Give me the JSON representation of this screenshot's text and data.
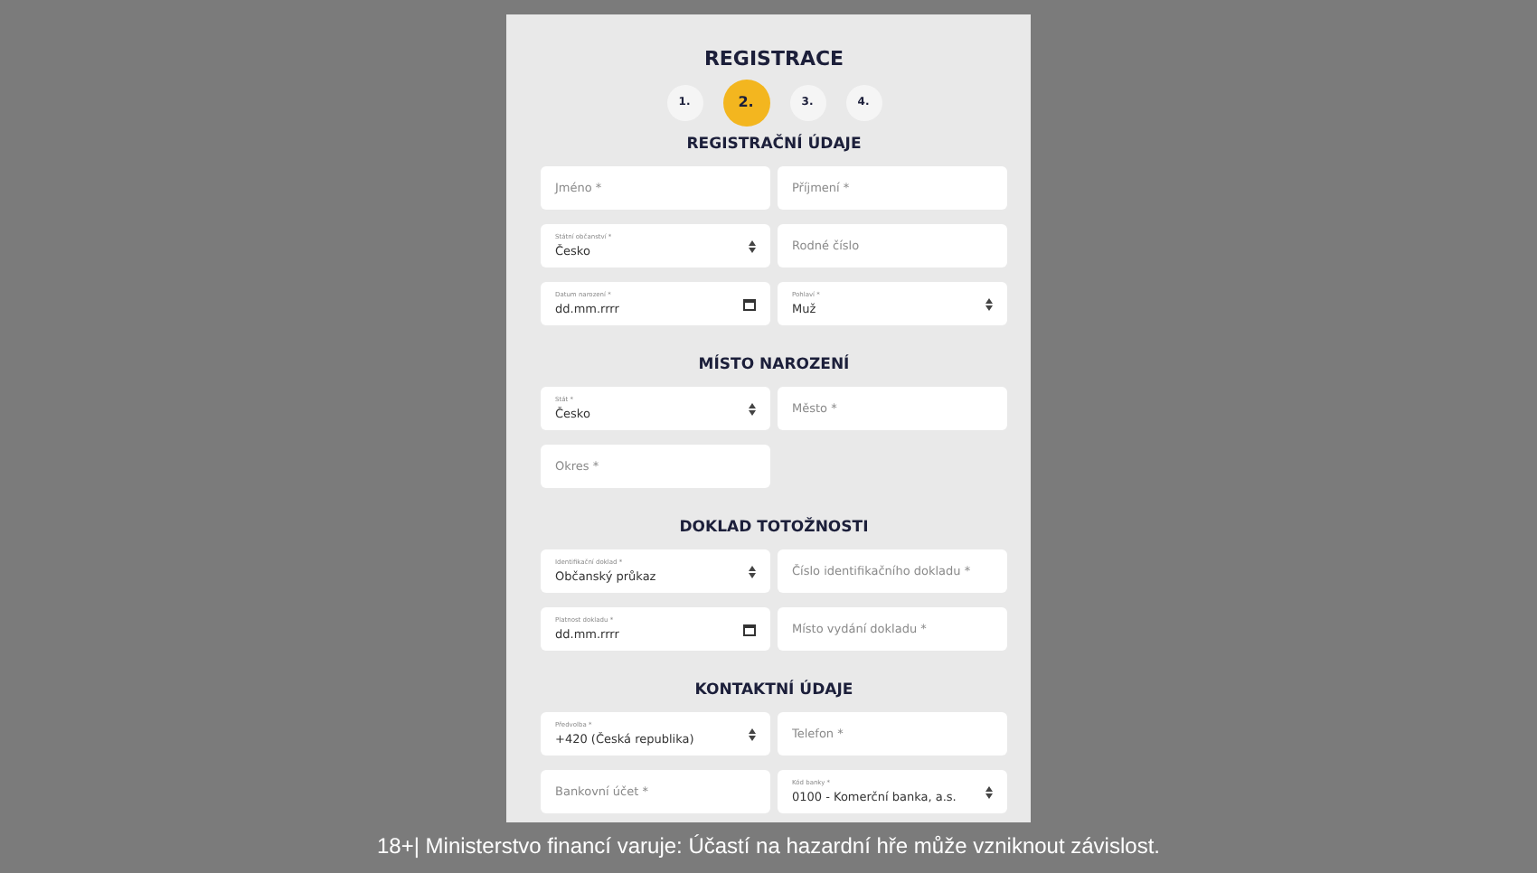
{
  "title": "REGISTRACE",
  "steps": [
    {
      "number": "1.",
      "selected": false
    },
    {
      "number": "2.",
      "selected": true
    },
    {
      "number": "3.",
      "selected": false
    },
    {
      "number": "4.",
      "selected": false
    }
  ],
  "sections": [
    {
      "heading": "REGISTRAČNÍ ÚDAJE",
      "fields": [
        {
          "kind": "text",
          "placeholder": "Jméno *"
        },
        {
          "kind": "text",
          "placeholder": "Příjmení *"
        },
        {
          "kind": "select",
          "label": "Státní občanství *",
          "value": "Česko"
        },
        {
          "kind": "text",
          "placeholder": "Rodné číslo"
        },
        {
          "kind": "date",
          "label": "Datum narození *",
          "value": "dd.mm.rrrr"
        },
        {
          "kind": "select",
          "label": "Pohlaví *",
          "value": "Muž"
        }
      ]
    },
    {
      "heading": "MÍSTO NAROZENÍ",
      "fields": [
        {
          "kind": "select",
          "label": "Stát *",
          "value": "Česko"
        },
        {
          "kind": "text",
          "placeholder": "Město *"
        },
        {
          "kind": "text",
          "placeholder": "Okres *"
        }
      ]
    },
    {
      "heading": "DOKLAD TOTOŽNOSTI",
      "fields": [
        {
          "kind": "select",
          "label": "Identifikační doklad *",
          "value": "Občanský průkaz"
        },
        {
          "kind": "text",
          "placeholder": "Číslo identifikačního dokladu *"
        },
        {
          "kind": "date",
          "label": "Platnost dokladu *",
          "value": "dd.mm.rrrr"
        },
        {
          "kind": "text",
          "placeholder": "Místo vydání dokladu *"
        }
      ]
    },
    {
      "heading": "KONTAKTNÍ ÚDAJE",
      "fields": [
        {
          "kind": "select",
          "label": "Předvolba *",
          "value": "+420 (Česká republika)"
        },
        {
          "kind": "text",
          "placeholder": "Telefon *"
        },
        {
          "kind": "text",
          "placeholder": "Bankovní účet *"
        },
        {
          "kind": "select",
          "label": "Kód banky *",
          "value": "0100 - Komerční banka, a.s."
        }
      ]
    }
  ],
  "footer": "18+| Ministerstvo financí varuje: Účastí na hazardní hře může vzniknout závislost."
}
